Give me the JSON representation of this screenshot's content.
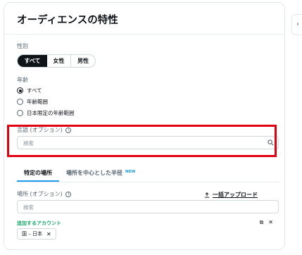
{
  "panel": {
    "title": "オーディエンスの特性"
  },
  "gender": {
    "label": "性別",
    "options": [
      "すべて",
      "女性",
      "男性"
    ],
    "selected": "すべて"
  },
  "age": {
    "label": "年齢",
    "options": [
      "すべて",
      "年齢範囲",
      "日本限定の年齢範囲"
    ],
    "selected": "すべて"
  },
  "language": {
    "label": "言語 (オプション)",
    "placeholder": "検索"
  },
  "location_tabs": {
    "tabs": [
      "特定の場所",
      "場所を中心とした半径"
    ],
    "new_badge": "NEW",
    "active": "特定の場所"
  },
  "location": {
    "label": "場所 (オプション)",
    "upload_label": "一括アップロード",
    "placeholder": "検索",
    "added_label": "追加するアカウント",
    "chips": [
      "国 – 日本"
    ]
  },
  "colors": {
    "accent": "#1d9bf0",
    "highlight": "#e0000f",
    "added_green": "#17a86b"
  }
}
